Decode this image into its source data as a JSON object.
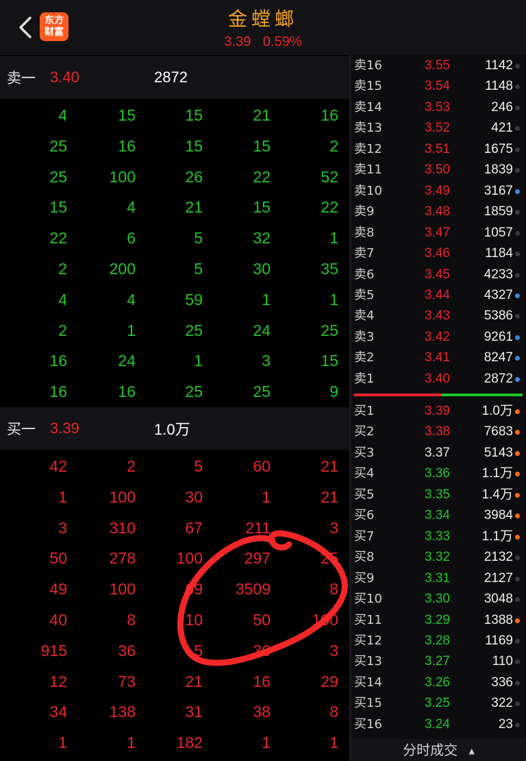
{
  "header": {
    "title": "金螳螂",
    "price": "3.39",
    "change_pct": "0.59%",
    "logo_line1": "东方",
    "logo_line2": "财富"
  },
  "level1": {
    "sell": {
      "label": "卖一",
      "price": "3.40",
      "volume": "2872"
    },
    "buy": {
      "label": "买一",
      "price": "3.39",
      "volume": "1.0万"
    }
  },
  "sell_queue": [
    [
      "4",
      "15",
      "15",
      "21",
      "16"
    ],
    [
      "25",
      "16",
      "15",
      "15",
      "2"
    ],
    [
      "25",
      "100",
      "26",
      "22",
      "52"
    ],
    [
      "15",
      "4",
      "21",
      "15",
      "22"
    ],
    [
      "22",
      "6",
      "5",
      "32",
      "1"
    ],
    [
      "2",
      "200",
      "5",
      "30",
      "35"
    ],
    [
      "4",
      "4",
      "59",
      "1",
      "1"
    ],
    [
      "2",
      "1",
      "25",
      "24",
      "25"
    ],
    [
      "16",
      "24",
      "1",
      "3",
      "15"
    ],
    [
      "16",
      "16",
      "25",
      "25",
      "9"
    ]
  ],
  "buy_queue": [
    [
      "42",
      "2",
      "5",
      "60",
      "21"
    ],
    [
      "1",
      "100",
      "30",
      "1",
      "21"
    ],
    [
      "3",
      "310",
      "67",
      "211",
      "3"
    ],
    [
      "50",
      "278",
      "100",
      "297",
      "25"
    ],
    [
      "49",
      "100",
      "69",
      "3509",
      "8"
    ],
    [
      "40",
      "8",
      "10",
      "50",
      "100"
    ],
    [
      "915",
      "36",
      "5",
      "36",
      "3"
    ],
    [
      "12",
      "73",
      "21",
      "16",
      "29"
    ],
    [
      "34",
      "138",
      "31",
      "38",
      "8"
    ],
    [
      "1",
      "1",
      "182",
      "1",
      "1"
    ]
  ],
  "order_book": {
    "asks": [
      {
        "label": "卖16",
        "price": "3.55",
        "volume": "1142",
        "dot": "gray"
      },
      {
        "label": "卖15",
        "price": "3.54",
        "volume": "1148",
        "dot": "gray"
      },
      {
        "label": "卖14",
        "price": "3.53",
        "volume": "246",
        "dot": "gray"
      },
      {
        "label": "卖13",
        "price": "3.52",
        "volume": "421",
        "dot": "gray"
      },
      {
        "label": "卖12",
        "price": "3.51",
        "volume": "1675",
        "dot": "gray"
      },
      {
        "label": "卖11",
        "price": "3.50",
        "volume": "1839",
        "dot": "gray"
      },
      {
        "label": "卖10",
        "price": "3.49",
        "volume": "3167",
        "dot": "blue"
      },
      {
        "label": "卖9",
        "price": "3.48",
        "volume": "1859",
        "dot": "gray"
      },
      {
        "label": "卖8",
        "price": "3.47",
        "volume": "1057",
        "dot": "gray"
      },
      {
        "label": "卖7",
        "price": "3.46",
        "volume": "1184",
        "dot": "gray"
      },
      {
        "label": "卖6",
        "price": "3.45",
        "volume": "4233",
        "dot": "gray"
      },
      {
        "label": "卖5",
        "price": "3.44",
        "volume": "4327",
        "dot": "blue"
      },
      {
        "label": "卖4",
        "price": "3.43",
        "volume": "5386",
        "dot": "gray"
      },
      {
        "label": "卖3",
        "price": "3.42",
        "volume": "9261",
        "dot": "blue"
      },
      {
        "label": "卖2",
        "price": "3.41",
        "volume": "8247",
        "dot": "blue"
      },
      {
        "label": "卖1",
        "price": "3.40",
        "volume": "2872",
        "dot": "blue"
      }
    ],
    "bids": [
      {
        "label": "买1",
        "price": "3.39",
        "volume": "1.0万",
        "dot": "orange",
        "color": "red"
      },
      {
        "label": "买2",
        "price": "3.38",
        "volume": "7683",
        "dot": "orange",
        "color": "red"
      },
      {
        "label": "买3",
        "price": "3.37",
        "volume": "5143",
        "dot": "orange",
        "color": "white"
      },
      {
        "label": "买4",
        "price": "3.36",
        "volume": "1.1万",
        "dot": "orange",
        "color": "green"
      },
      {
        "label": "买5",
        "price": "3.35",
        "volume": "1.4万",
        "dot": "orange",
        "color": "green"
      },
      {
        "label": "买6",
        "price": "3.34",
        "volume": "3984",
        "dot": "orange",
        "color": "green"
      },
      {
        "label": "买7",
        "price": "3.33",
        "volume": "1.1万",
        "dot": "orange",
        "color": "green"
      },
      {
        "label": "买8",
        "price": "3.32",
        "volume": "2132",
        "dot": "gray",
        "color": "green"
      },
      {
        "label": "买9",
        "price": "3.31",
        "volume": "2127",
        "dot": "gray",
        "color": "green"
      },
      {
        "label": "买10",
        "price": "3.30",
        "volume": "3048",
        "dot": "gray",
        "color": "green"
      },
      {
        "label": "买11",
        "price": "3.29",
        "volume": "1388",
        "dot": "orange",
        "color": "green"
      },
      {
        "label": "买12",
        "price": "3.28",
        "volume": "1169",
        "dot": "gray",
        "color": "green"
      },
      {
        "label": "买13",
        "price": "3.27",
        "volume": "110",
        "dot": "gray",
        "color": "green"
      },
      {
        "label": "买14",
        "price": "3.26",
        "volume": "336",
        "dot": "gray",
        "color": "green"
      },
      {
        "label": "买15",
        "price": "3.25",
        "volume": "322",
        "dot": "gray",
        "color": "green"
      },
      {
        "label": "买16",
        "price": "3.24",
        "volume": "23",
        "dot": "gray",
        "color": "green"
      }
    ],
    "buy_ratio": 0.52
  },
  "footer": {
    "label": "分时成交",
    "arrow": "▲"
  },
  "icons": {
    "back": "back-chevron-icon",
    "logo": "eastmoney-logo-icon"
  },
  "colors": {
    "up": "#e8262b",
    "down": "#22c52a",
    "title": "#f0a020",
    "ask_dot": "#3f86e0",
    "bid_dot": "#ff6a13"
  }
}
